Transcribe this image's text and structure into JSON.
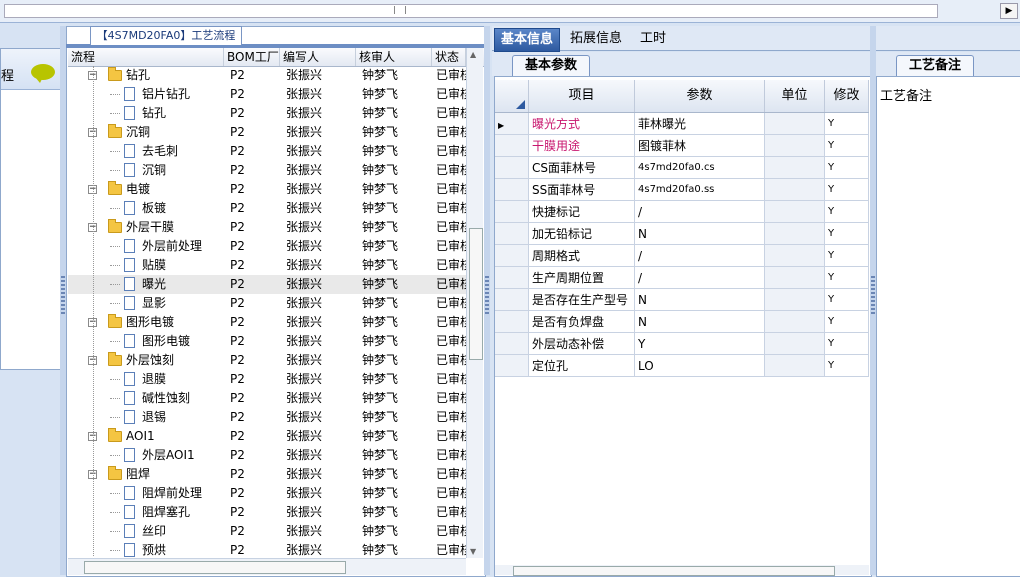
{
  "left_panel": {
    "label": "程"
  },
  "flow_panel": {
    "title": "【4S7MD20FA0】工艺流程",
    "columns": [
      "流程",
      "BOM工厂",
      "编写人",
      "核审人",
      "状态"
    ],
    "rows": [
      {
        "name": "钻孔",
        "type": "folder",
        "bom": "P2",
        "writer": "张振兴",
        "reviewer": "钟梦飞",
        "status": "已审核"
      },
      {
        "name": "铝片钻孔",
        "type": "doc",
        "bom": "P2",
        "writer": "张振兴",
        "reviewer": "钟梦飞",
        "status": "已审核"
      },
      {
        "name": "钻孔",
        "type": "doc",
        "bom": "P2",
        "writer": "张振兴",
        "reviewer": "钟梦飞",
        "status": "已审核"
      },
      {
        "name": "沉铜",
        "type": "folder",
        "bom": "P2",
        "writer": "张振兴",
        "reviewer": "钟梦飞",
        "status": "已审核"
      },
      {
        "name": "去毛刺",
        "type": "doc",
        "bom": "P2",
        "writer": "张振兴",
        "reviewer": "钟梦飞",
        "status": "已审核"
      },
      {
        "name": "沉铜",
        "type": "doc",
        "bom": "P2",
        "writer": "张振兴",
        "reviewer": "钟梦飞",
        "status": "已审核"
      },
      {
        "name": "电镀",
        "type": "folder",
        "bom": "P2",
        "writer": "张振兴",
        "reviewer": "钟梦飞",
        "status": "已审核"
      },
      {
        "name": "板镀",
        "type": "doc",
        "bom": "P2",
        "writer": "张振兴",
        "reviewer": "钟梦飞",
        "status": "已审核"
      },
      {
        "name": "外层干膜",
        "type": "folder",
        "bom": "P2",
        "writer": "张振兴",
        "reviewer": "钟梦飞",
        "status": "已审核"
      },
      {
        "name": "外层前处理",
        "type": "doc",
        "bom": "P2",
        "writer": "张振兴",
        "reviewer": "钟梦飞",
        "status": "已审核"
      },
      {
        "name": "贴膜",
        "type": "doc",
        "bom": "P2",
        "writer": "张振兴",
        "reviewer": "钟梦飞",
        "status": "已审核"
      },
      {
        "name": "曝光",
        "type": "doc",
        "bom": "P2",
        "writer": "张振兴",
        "reviewer": "钟梦飞",
        "status": "已审核",
        "selected": true
      },
      {
        "name": "显影",
        "type": "doc",
        "bom": "P2",
        "writer": "张振兴",
        "reviewer": "钟梦飞",
        "status": "已审核"
      },
      {
        "name": "图形电镀",
        "type": "folder",
        "bom": "P2",
        "writer": "张振兴",
        "reviewer": "钟梦飞",
        "status": "已审核"
      },
      {
        "name": "图形电镀",
        "type": "doc",
        "bom": "P2",
        "writer": "张振兴",
        "reviewer": "钟梦飞",
        "status": "已审核"
      },
      {
        "name": "外层蚀刻",
        "type": "folder",
        "bom": "P2",
        "writer": "张振兴",
        "reviewer": "钟梦飞",
        "status": "已审核"
      },
      {
        "name": "退膜",
        "type": "doc",
        "bom": "P2",
        "writer": "张振兴",
        "reviewer": "钟梦飞",
        "status": "已审核"
      },
      {
        "name": "碱性蚀刻",
        "type": "doc",
        "bom": "P2",
        "writer": "张振兴",
        "reviewer": "钟梦飞",
        "status": "已审核"
      },
      {
        "name": "退锡",
        "type": "doc",
        "bom": "P2",
        "writer": "张振兴",
        "reviewer": "钟梦飞",
        "status": "已审核"
      },
      {
        "name": "AOI1",
        "type": "folder",
        "bom": "P2",
        "writer": "张振兴",
        "reviewer": "钟梦飞",
        "status": "已审核"
      },
      {
        "name": "外层AOI1",
        "type": "doc",
        "bom": "P2",
        "writer": "张振兴",
        "reviewer": "钟梦飞",
        "status": "已审核"
      },
      {
        "name": "阻焊",
        "type": "folder",
        "bom": "P2",
        "writer": "张振兴",
        "reviewer": "钟梦飞",
        "status": "已审核"
      },
      {
        "name": "阻焊前处理",
        "type": "doc",
        "bom": "P2",
        "writer": "张振兴",
        "reviewer": "钟梦飞",
        "status": "已审核"
      },
      {
        "name": "阻焊塞孔",
        "type": "doc",
        "bom": "P2",
        "writer": "张振兴",
        "reviewer": "钟梦飞",
        "status": "已审核"
      },
      {
        "name": "丝印",
        "type": "doc",
        "bom": "P2",
        "writer": "张振兴",
        "reviewer": "钟梦飞",
        "status": "已审核"
      },
      {
        "name": "预烘",
        "type": "doc",
        "bom": "P2",
        "writer": "张振兴",
        "reviewer": "钟梦飞",
        "status": "已审核"
      }
    ]
  },
  "main_tabs": [
    "基本信息",
    "拓展信息",
    "工时"
  ],
  "sub_tab": "基本参数",
  "grid": {
    "columns": [
      "项目",
      "参数",
      "单位",
      "修改"
    ],
    "rows": [
      {
        "item": "曝光方式",
        "param": "菲林曝光",
        "unit": "",
        "modify": "Y",
        "highlight": true,
        "current": true
      },
      {
        "item": "干膜用途",
        "param": "图镀菲林",
        "unit": "",
        "modify": "Y",
        "highlight": true
      },
      {
        "item": "CS面菲林号",
        "param": "4s7md20fa0.cs",
        "unit": "",
        "modify": "Y"
      },
      {
        "item": "SS面菲林号",
        "param": "4s7md20fa0.ss",
        "unit": "",
        "modify": "Y"
      },
      {
        "item": "快捷标记",
        "param": "/",
        "unit": "",
        "modify": "Y"
      },
      {
        "item": "加无铅标记",
        "param": "N",
        "unit": "",
        "modify": "Y"
      },
      {
        "item": "周期格式",
        "param": "/",
        "unit": "",
        "modify": "Y"
      },
      {
        "item": "生产周期位置",
        "param": "/",
        "unit": "",
        "modify": "Y"
      },
      {
        "item": "是否存在生产型号",
        "param": "N",
        "unit": "",
        "modify": "Y"
      },
      {
        "item": "是否有负焊盘",
        "param": "N",
        "unit": "",
        "modify": "Y"
      },
      {
        "item": "外层动态补偿",
        "param": "Y",
        "unit": "",
        "modify": "Y"
      },
      {
        "item": "定位孔",
        "param": "LO",
        "unit": "",
        "modify": "Y"
      }
    ]
  },
  "notes_panel": {
    "tab": "工艺备注",
    "label": "工艺备注"
  }
}
